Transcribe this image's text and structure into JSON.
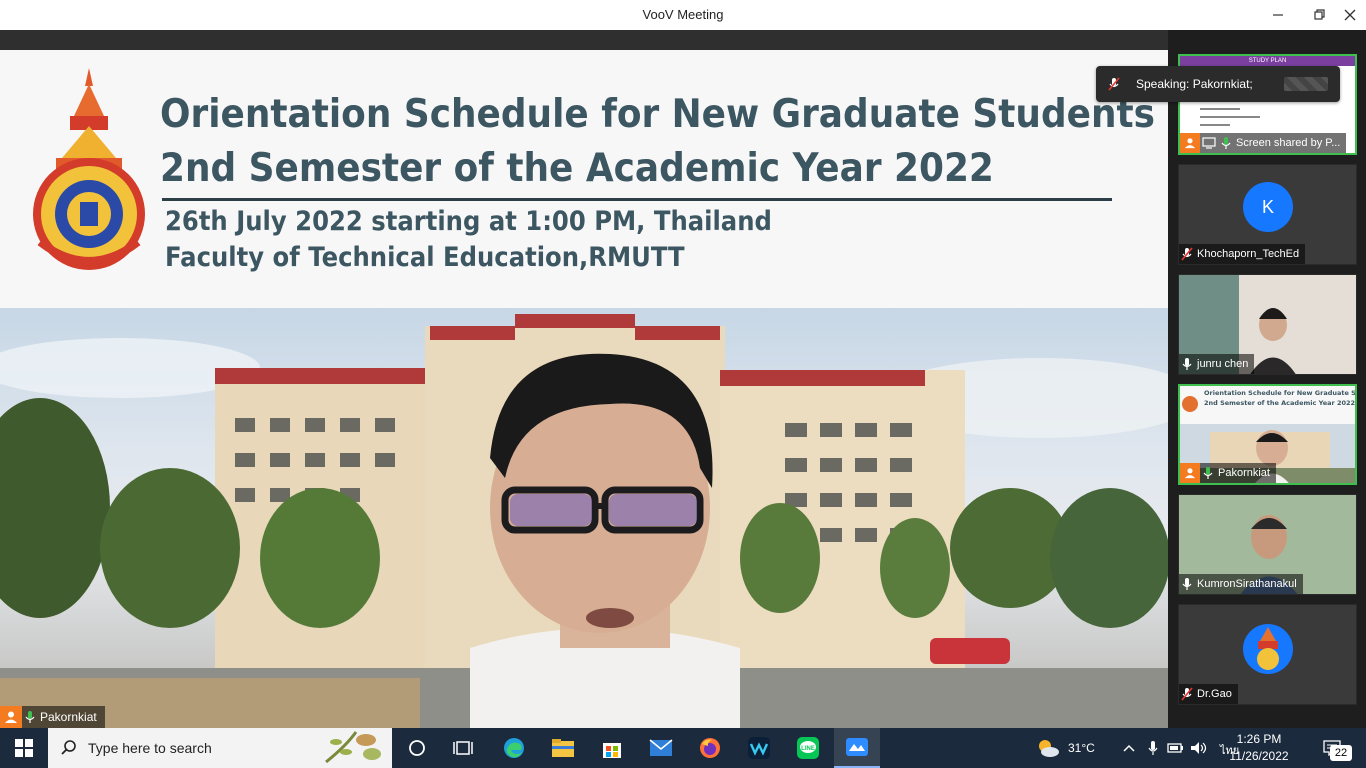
{
  "window": {
    "title": "VooV Meeting"
  },
  "slide": {
    "title_line1": "Orientation Schedule for New Graduate Students",
    "title_line2": "2nd Semester of the Academic Year 2022",
    "subtitle_line1": "26th July 2022 starting at 1:00 PM, Thailand",
    "subtitle_line2": "Faculty of Technical Education,RMUTT"
  },
  "main_speaker": {
    "name": "Pakornkiat"
  },
  "speaking_indicator": {
    "text": "Speaking: Pakornkiat;"
  },
  "participants": [
    {
      "label": "Screen shared by P...",
      "host": true,
      "sharing": true,
      "active": true,
      "thumb_header": "STUDY PLAN"
    },
    {
      "label": "Khochaporn_TechEd",
      "host": false,
      "avatar_letter": "K",
      "muted": true
    },
    {
      "label": "junru  chen",
      "host": false,
      "muted": false
    },
    {
      "label": "Pakornkiat",
      "host": true,
      "muted": false,
      "active": true,
      "thumb_title1": "Orientation Schedule for New Graduate Students",
      "thumb_title2": "2nd Semester of the Academic Year 2022"
    },
    {
      "label": "KumronSirathanakul",
      "host": false,
      "muted": false
    },
    {
      "label": "Dr.Gao",
      "host": false,
      "muted": true
    }
  ],
  "taskbar": {
    "search_placeholder": "Type here to search",
    "weather": "31°C",
    "language": "ไทย",
    "time": "1:26 PM",
    "date": "11/26/2022",
    "notifications": "22"
  },
  "colors": {
    "host_badge": "#f47b20",
    "active_border": "#3fbf4f",
    "avatar_blue": "#1677ff",
    "taskbar": "#1b2a3c"
  }
}
